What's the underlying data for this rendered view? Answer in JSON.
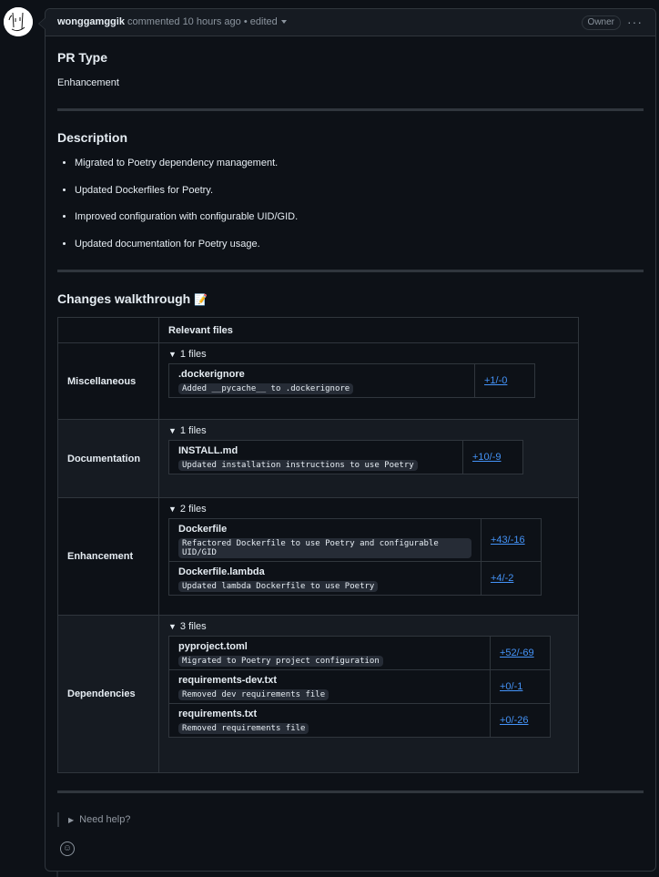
{
  "header": {
    "author": "wonggamggik",
    "action": "commented",
    "time": "10 hours ago",
    "separator": "•",
    "edited": "edited",
    "badge": "Owner",
    "more_icon": "kebab-horizontal-icon"
  },
  "pr_type": {
    "heading": "PR Type",
    "value": "Enhancement"
  },
  "description": {
    "heading": "Description",
    "items": [
      "Migrated to Poetry dependency management.",
      "Updated Dockerfiles for Poetry.",
      "Improved configuration with configurable UID/GID.",
      "Updated documentation for Poetry usage."
    ]
  },
  "walkthrough": {
    "heading": "Changes walkthrough",
    "emoji": "📝",
    "column_header": "Relevant files",
    "rows": [
      {
        "category": "Miscellaneous",
        "summary": "1 files",
        "files": [
          {
            "name": ".dockerignore",
            "note": "Added __pycache__ to .dockerignore",
            "stat": "+1/-0"
          }
        ]
      },
      {
        "category": "Documentation",
        "summary": "1 files",
        "files": [
          {
            "name": "INSTALL.md",
            "note": "Updated installation instructions to use Poetry",
            "stat": "+10/-9"
          }
        ]
      },
      {
        "category": "Enhancement",
        "summary": "2 files",
        "files": [
          {
            "name": "Dockerfile",
            "note": "Refactored Dockerfile to use Poetry and configurable UID/GID",
            "stat": "+43/-16"
          },
          {
            "name": "Dockerfile.lambda",
            "note": "Updated lambda Dockerfile to use Poetry",
            "stat": "+4/-2"
          }
        ]
      },
      {
        "category": "Dependencies",
        "summary": "3 files",
        "files": [
          {
            "name": "pyproject.toml",
            "note": "Migrated to Poetry project configuration",
            "stat": "+52/-69"
          },
          {
            "name": "requirements-dev.txt",
            "note": "Removed dev requirements file",
            "stat": "+0/-1"
          },
          {
            "name": "requirements.txt",
            "note": "Removed requirements file",
            "stat": "+0/-26"
          }
        ]
      }
    ]
  },
  "help": {
    "label": "Need help?"
  },
  "reaction_icon": "smiley-icon"
}
